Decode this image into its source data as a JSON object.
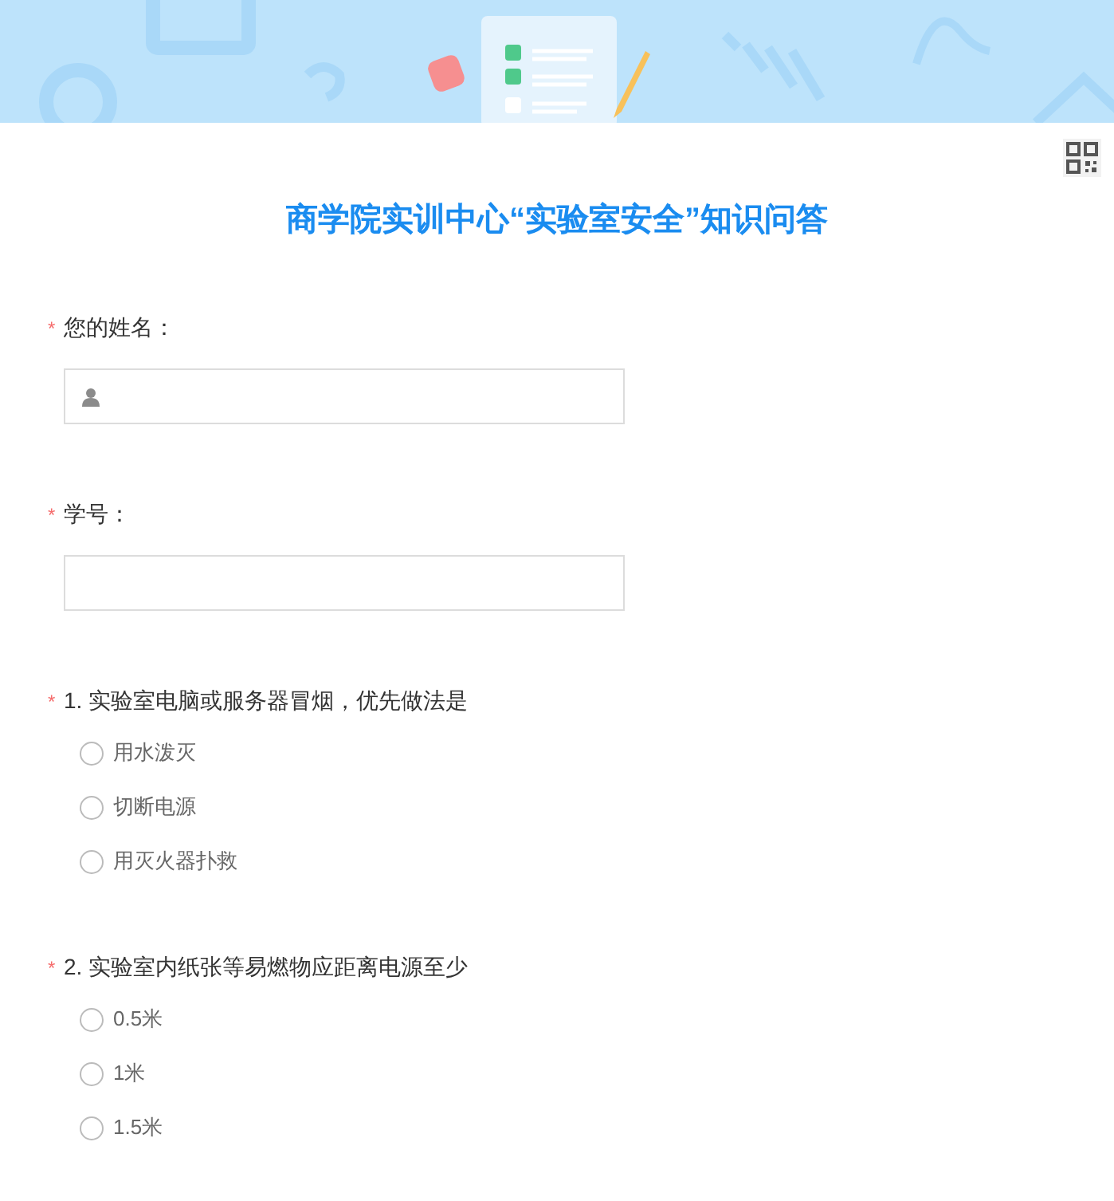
{
  "title": "商学院实训中心“实验室安全”知识问答",
  "questions": [
    {
      "kind": "name",
      "required_mark": "*",
      "label": "您的姓名："
    },
    {
      "kind": "text",
      "required_mark": "*",
      "label": "学号："
    },
    {
      "kind": "choice",
      "required_mark": "*",
      "label": "1. 实验室电脑或服务器冒烟，优先做法是",
      "options": [
        {
          "label": "用水泼灭",
          "selected": false
        },
        {
          "label": "切断电源",
          "selected": false
        },
        {
          "label": "用灭火器扑救",
          "selected": false
        }
      ]
    },
    {
      "kind": "choice",
      "required_mark": "*",
      "label": "2. 实验室内纸张等易燃物应距离电源至少",
      "options": [
        {
          "label": "0.5米",
          "selected": false
        },
        {
          "label": "1米",
          "selected": false
        },
        {
          "label": "1.5米",
          "selected": false
        }
      ]
    }
  ]
}
